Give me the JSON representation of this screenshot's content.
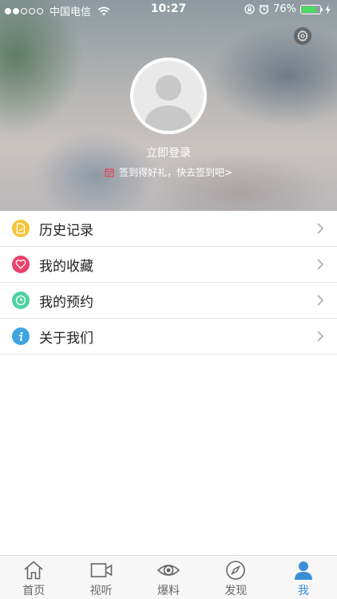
{
  "status_bar": {
    "carrier": "中国电信",
    "time": "10:27",
    "battery": "76%",
    "signal_strength": 2,
    "signal_max": 5
  },
  "profile": {
    "login_text": "立即登录",
    "checkin_text": "签到得好礼，快去签到吧>"
  },
  "menu": [
    {
      "label": "历史记录",
      "icon": "history-icon",
      "color": "#f3c53b"
    },
    {
      "label": "我的收藏",
      "icon": "favorite-heart-icon",
      "color": "#e8436a"
    },
    {
      "label": "我的预约",
      "icon": "clock-icon",
      "color": "#4fd1a1"
    },
    {
      "label": "关于我们",
      "icon": "info-icon",
      "color": "#3ea5e0"
    }
  ],
  "tabs": [
    {
      "label": "首页",
      "icon": "home-icon",
      "active": false
    },
    {
      "label": "视听",
      "icon": "video-camera-icon",
      "active": false
    },
    {
      "label": "爆料",
      "icon": "eye-icon",
      "active": false
    },
    {
      "label": "发现",
      "icon": "compass-icon",
      "active": false
    },
    {
      "label": "我",
      "icon": "person-icon",
      "active": true
    }
  ],
  "colors": {
    "accent": "#3b8fd6",
    "battery": "#4cd964"
  }
}
